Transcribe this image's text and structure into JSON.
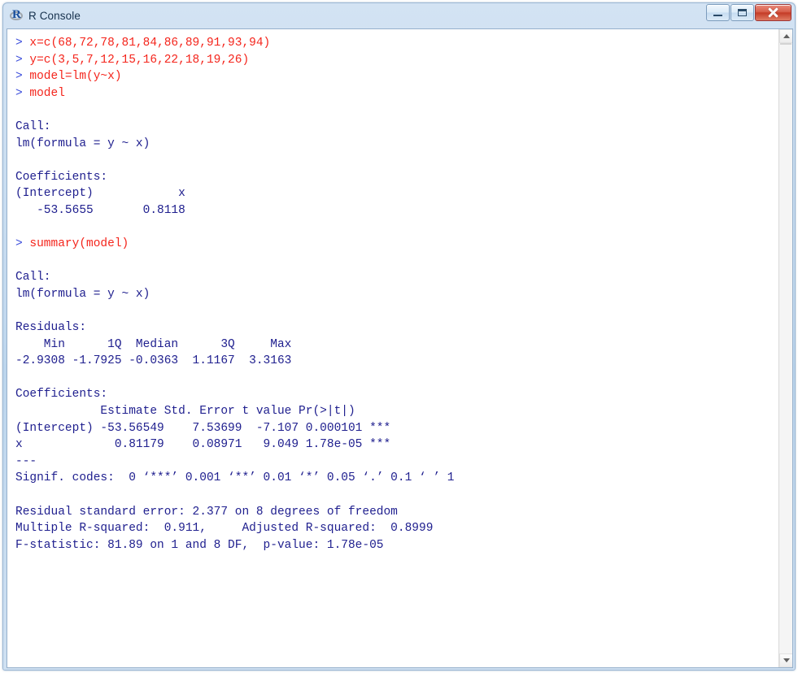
{
  "window": {
    "title": "R Console",
    "icon": "r-logo-icon",
    "buttons": {
      "minimize": "Minimize",
      "maximize": "Maximize",
      "close": "Close"
    }
  },
  "colors": {
    "input_text": "#f4251c",
    "output_text": "#20208f",
    "prompt": "#3b4ddb",
    "titlebar_start": "#d3e3f3",
    "titlebar_end": "#cfe0f1",
    "close_button": "#c43c27",
    "console_background": "#ffffff"
  },
  "console": {
    "prompt_symbol": ">",
    "lines": [
      {
        "type": "input",
        "prompt": "> ",
        "text": "x=c(68,72,78,81,84,86,89,91,93,94)"
      },
      {
        "type": "input",
        "prompt": "> ",
        "text": "y=c(3,5,7,12,15,16,22,18,19,26)"
      },
      {
        "type": "input",
        "prompt": "> ",
        "text": "model=lm(y~x)"
      },
      {
        "type": "input",
        "prompt": "> ",
        "text": "model"
      },
      {
        "type": "blank",
        "text": ""
      },
      {
        "type": "output",
        "text": "Call:"
      },
      {
        "type": "output",
        "text": "lm(formula = y ~ x)"
      },
      {
        "type": "blank",
        "text": ""
      },
      {
        "type": "output",
        "text": "Coefficients:"
      },
      {
        "type": "output",
        "text": "(Intercept)            x  "
      },
      {
        "type": "output",
        "text": "   -53.5655       0.8118  "
      },
      {
        "type": "blank",
        "text": ""
      },
      {
        "type": "input",
        "prompt": "> ",
        "text": "summary(model)"
      },
      {
        "type": "blank",
        "text": ""
      },
      {
        "type": "output",
        "text": "Call:"
      },
      {
        "type": "output",
        "text": "lm(formula = y ~ x)"
      },
      {
        "type": "blank",
        "text": ""
      },
      {
        "type": "output",
        "text": "Residuals:"
      },
      {
        "type": "output",
        "text": "    Min      1Q  Median      3Q     Max "
      },
      {
        "type": "output",
        "text": "-2.9308 -1.7925 -0.0363  1.1167  3.3163 "
      },
      {
        "type": "blank",
        "text": ""
      },
      {
        "type": "output",
        "text": "Coefficients:"
      },
      {
        "type": "output",
        "text": "            Estimate Std. Error t value Pr(>|t|)    "
      },
      {
        "type": "output",
        "text": "(Intercept) -53.56549    7.53699  -7.107 0.000101 ***"
      },
      {
        "type": "output",
        "text": "x             0.81179    0.08971   9.049 1.78e-05 ***"
      },
      {
        "type": "output",
        "text": "---"
      },
      {
        "type": "output",
        "text": "Signif. codes:  0 ‘***’ 0.001 ‘**’ 0.01 ‘*’ 0.05 ‘.’ 0.1 ‘ ’ 1"
      },
      {
        "type": "blank",
        "text": ""
      },
      {
        "type": "output",
        "text": "Residual standard error: 2.377 on 8 degrees of freedom"
      },
      {
        "type": "output",
        "text": "Multiple R-squared:  0.911,\tAdjusted R-squared:  0.8999 "
      },
      {
        "type": "output",
        "text": "F-statistic: 81.89 on 1 and 8 DF,  p-value: 1.78e-05"
      },
      {
        "type": "blank",
        "text": ""
      },
      {
        "type": "output",
        "text": " "
      }
    ]
  },
  "analysis_values": {
    "x": [
      68,
      72,
      78,
      81,
      84,
      86,
      89,
      91,
      93,
      94
    ],
    "y": [
      3,
      5,
      7,
      12,
      15,
      16,
      22,
      18,
      19,
      26
    ],
    "intercept": -53.5655,
    "slope": 0.8118,
    "residuals": {
      "min": -2.9308,
      "q1": -1.7925,
      "median": -0.0363,
      "q3": 1.1167,
      "max": 3.3163
    },
    "coefficients": [
      {
        "term": "(Intercept)",
        "estimate": -53.56549,
        "std_error": 7.53699,
        "t_value": -7.107,
        "p_value": "0.000101",
        "signif": "***"
      },
      {
        "term": "x",
        "estimate": 0.81179,
        "std_error": 0.08971,
        "t_value": 9.049,
        "p_value": "1.78e-05",
        "signif": "***"
      }
    ],
    "residual_standard_error": 2.377,
    "degrees_of_freedom": 8,
    "r_squared": 0.911,
    "adjusted_r_squared": 0.8999,
    "f_statistic": 81.89,
    "f_df": [
      1,
      8
    ],
    "p_value": "1.78e-05"
  },
  "scrollbar": {
    "up_arrow": "scroll-up",
    "down_arrow": "scroll-down"
  }
}
